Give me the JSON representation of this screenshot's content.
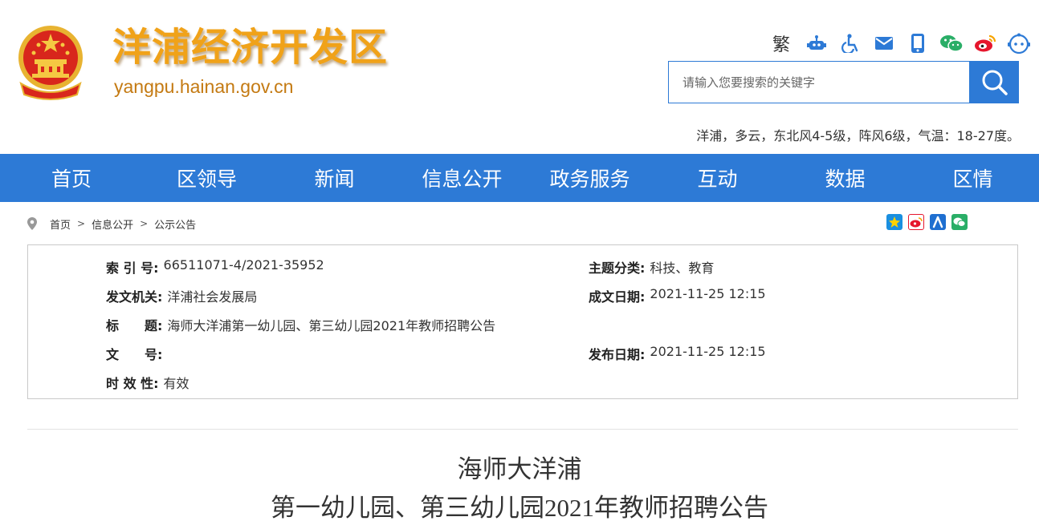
{
  "header": {
    "site_title": "洋浦经济开发区",
    "site_domain": "yangpu.hainan.gov.cn",
    "emblem_icon": "national-emblem-icon",
    "tools": {
      "traditional_label": "繁",
      "icons": [
        "robot-icon",
        "accessibility-icon",
        "mail-icon",
        "mobile-icon",
        "wechat-icon",
        "weibo-icon",
        "assistant-bot-icon"
      ]
    },
    "search": {
      "placeholder": "请输入您要搜索的关键字",
      "value": ""
    },
    "weather": "洋浦，多云，东北风4-5级，阵风6级，气温：18-27度。"
  },
  "nav": {
    "items": [
      "首页",
      "区领导",
      "新闻",
      "信息公开",
      "政务服务",
      "互动",
      "数据",
      "区情"
    ]
  },
  "breadcrumb": {
    "items": [
      "首页",
      "信息公开",
      "公示公告"
    ]
  },
  "share": {
    "icons": [
      "qzone-share-icon",
      "weibo-share-icon",
      "renren-share-icon",
      "wechat-share-icon"
    ]
  },
  "info": {
    "index_label": "索 引 号:",
    "index_value": "66511071-4/2021-35952",
    "topic_label": "主题分类:",
    "topic_value": "科技、教育",
    "issuer_label": "发文机关:",
    "issuer_value": "洋浦社会发展局",
    "written_date_label": "成文日期:",
    "written_date_value": "2021-11-25 12:15",
    "title_label": "标　　题:",
    "title_value": "海师大洋浦第一幼儿园、第三幼儿园2021年教师招聘公告",
    "doc_no_label": "文　　号:",
    "doc_no_value": "",
    "publish_date_label": "发布日期:",
    "publish_date_value": "2021-11-25 12:15",
    "validity_label": "时 效 性:",
    "validity_value": "有效"
  },
  "article": {
    "title_line1": "海师大洋浦",
    "title_line2": "第一幼儿园、第三幼儿园2021年教师招聘公告"
  },
  "colors": {
    "primary_blue": "#2d7ad6",
    "title_orange": "#f0a219",
    "domain_orange": "#c47a12"
  }
}
